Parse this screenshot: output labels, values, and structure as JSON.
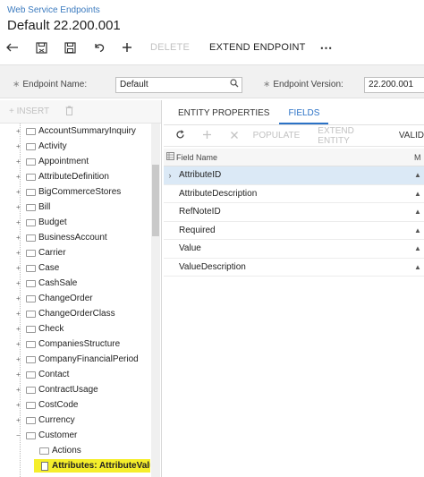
{
  "header": {
    "breadcrumb": "Web Service Endpoints",
    "title": "Default 22.200.001"
  },
  "toolbar": {
    "icons": [
      "back-arrow-icon",
      "save-close-icon",
      "save-icon",
      "undo-icon",
      "plus-icon"
    ],
    "delete_label": "DELETE",
    "extend_label": "EXTEND ENDPOINT",
    "more_label": "⋯"
  },
  "form": {
    "endpoint_name_label": "Endpoint Name:",
    "endpoint_name_value": "Default",
    "endpoint_version_label": "Endpoint Version:",
    "endpoint_version_value": "22.200.001",
    "required_marker": "∗"
  },
  "tree_toolbar": {
    "insert_label": "INSERT"
  },
  "tree": {
    "items": [
      "AccountSummaryInquiry",
      "Activity",
      "Appointment",
      "AttributeDefinition",
      "BigCommerceStores",
      "Bill",
      "Budget",
      "BusinessAccount",
      "Carrier",
      "Case",
      "CashSale",
      "ChangeOrder",
      "ChangeOrderClass",
      "Check",
      "CompaniesStructure",
      "CompanyFinancialPeriod",
      "Contact",
      "ContractUsage",
      "CostCode",
      "Currency",
      "Customer"
    ],
    "customer_children": {
      "actions": "Actions",
      "selected": "Attributes: AttributeValue"
    }
  },
  "tabs": {
    "entity_properties": "ENTITY PROPERTIES",
    "fields": "FIELDS"
  },
  "grid_toolbar": {
    "populate": "POPULATE",
    "extend_entity": "EXTEND ENTITY",
    "validate": "VALID"
  },
  "grid": {
    "column_field_name": "Field Name",
    "column_m": "M",
    "rows": [
      "AttributeID",
      "AttributeDescription",
      "RefNoteID",
      "Required",
      "Value",
      "ValueDescription"
    ]
  },
  "colors": {
    "accent": "#2b72c6",
    "selection_highlight": "#f5ee2b",
    "active_row": "#dbe9f6"
  }
}
